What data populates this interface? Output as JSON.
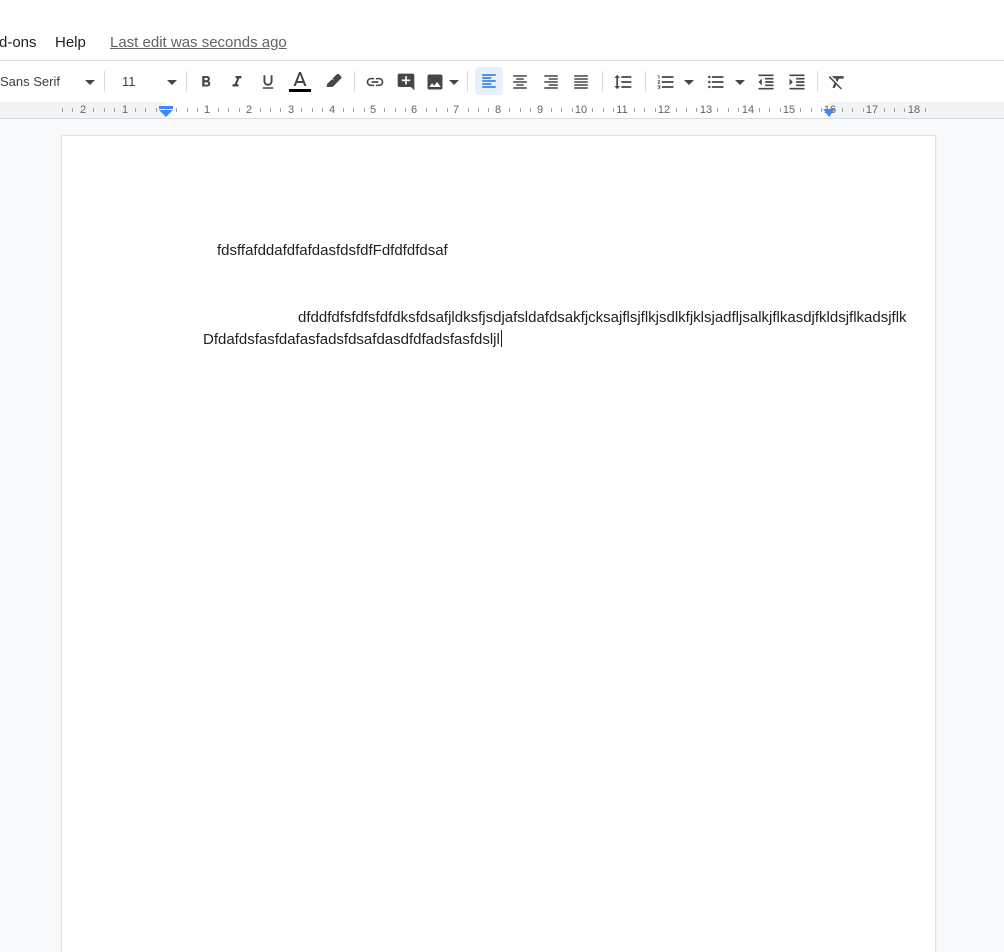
{
  "menu": {
    "addons_label": "d-ons",
    "help_label": "Help",
    "last_edit": "Last edit was seconds ago"
  },
  "toolbar": {
    "font_family": "Sans Serif",
    "font_size": "11",
    "text_color_indicator": "#000000",
    "accent_color": "#1a73e8",
    "icons": [
      "bold-icon",
      "italic-icon",
      "underline-icon",
      "text-color-icon",
      "highlight-icon",
      "link-icon",
      "add-comment-icon",
      "insert-image-icon",
      "align-left-icon",
      "align-center-icon",
      "align-right-icon",
      "justify-icon",
      "line-spacing-icon",
      "numbered-list-icon",
      "bulleted-list-icon",
      "decrease-indent-icon",
      "increase-indent-icon",
      "clear-formatting-icon"
    ],
    "active": "align-left"
  },
  "ruler": {
    "labels": [
      "2",
      "1",
      "1",
      "2",
      "3",
      "4",
      "5",
      "6",
      "7",
      "8",
      "9",
      "10",
      "11",
      "12",
      "13",
      "14",
      "15",
      "16",
      "17",
      "18"
    ]
  },
  "document": {
    "paragraphs": [
      "fdsffafddafdfafdasfdsfdfFdfdfdfdsaf",
      "dfddfdfsfdfsfdfdksfdsafjldksfjsdjafsldafdsakfjcksajflsjflkjsdlkfjklsjadfljsalkjflkasdjfkldsjflkadsjflk",
      "Dfdafdsfasfdafasfadsfdsafdasdfdfadsfasfdsljl"
    ]
  }
}
